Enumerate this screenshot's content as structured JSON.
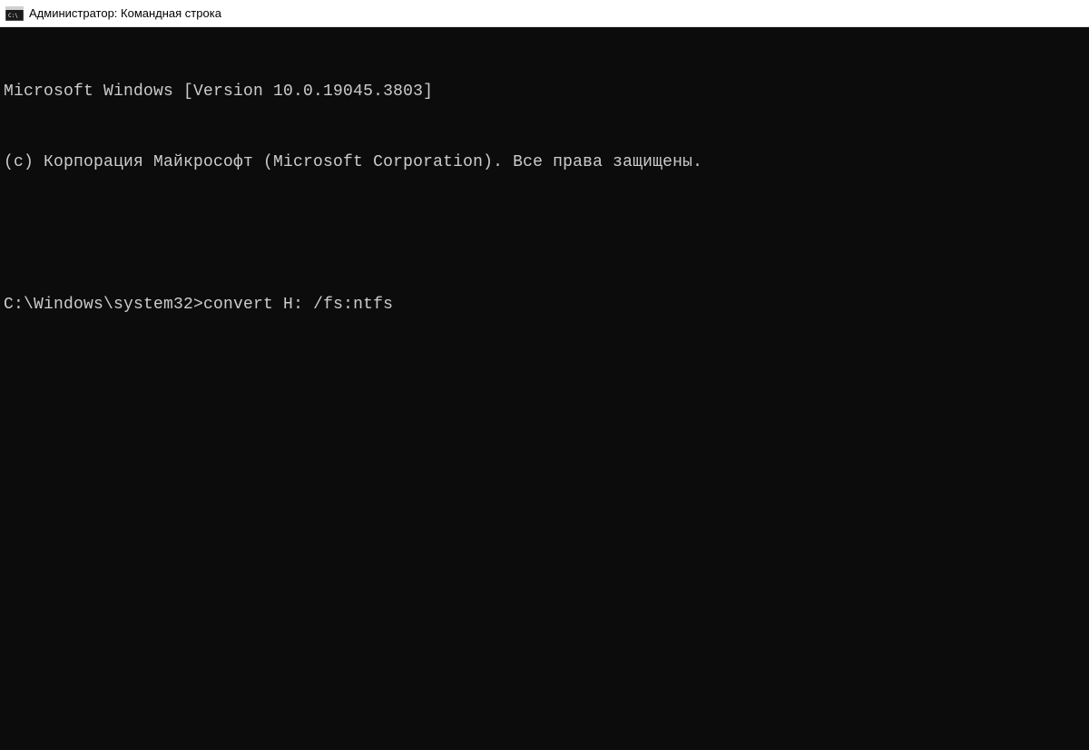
{
  "window": {
    "title": "Администратор: Командная строка",
    "icon_name": "cmd-icon"
  },
  "terminal": {
    "lines": {
      "version_line": "Microsoft Windows [Version 10.0.19045.3803]",
      "copyright_line": "(c) Корпорация Майкрософт (Microsoft Corporation). Все права защищены."
    },
    "prompt": "C:\\Windows\\system32>",
    "command": "convert H: /fs:ntfs"
  },
  "colors": {
    "terminal_bg": "#0c0c0c",
    "terminal_fg": "#cccccc",
    "titlebar_bg": "#ffffff",
    "titlebar_fg": "#000000"
  }
}
